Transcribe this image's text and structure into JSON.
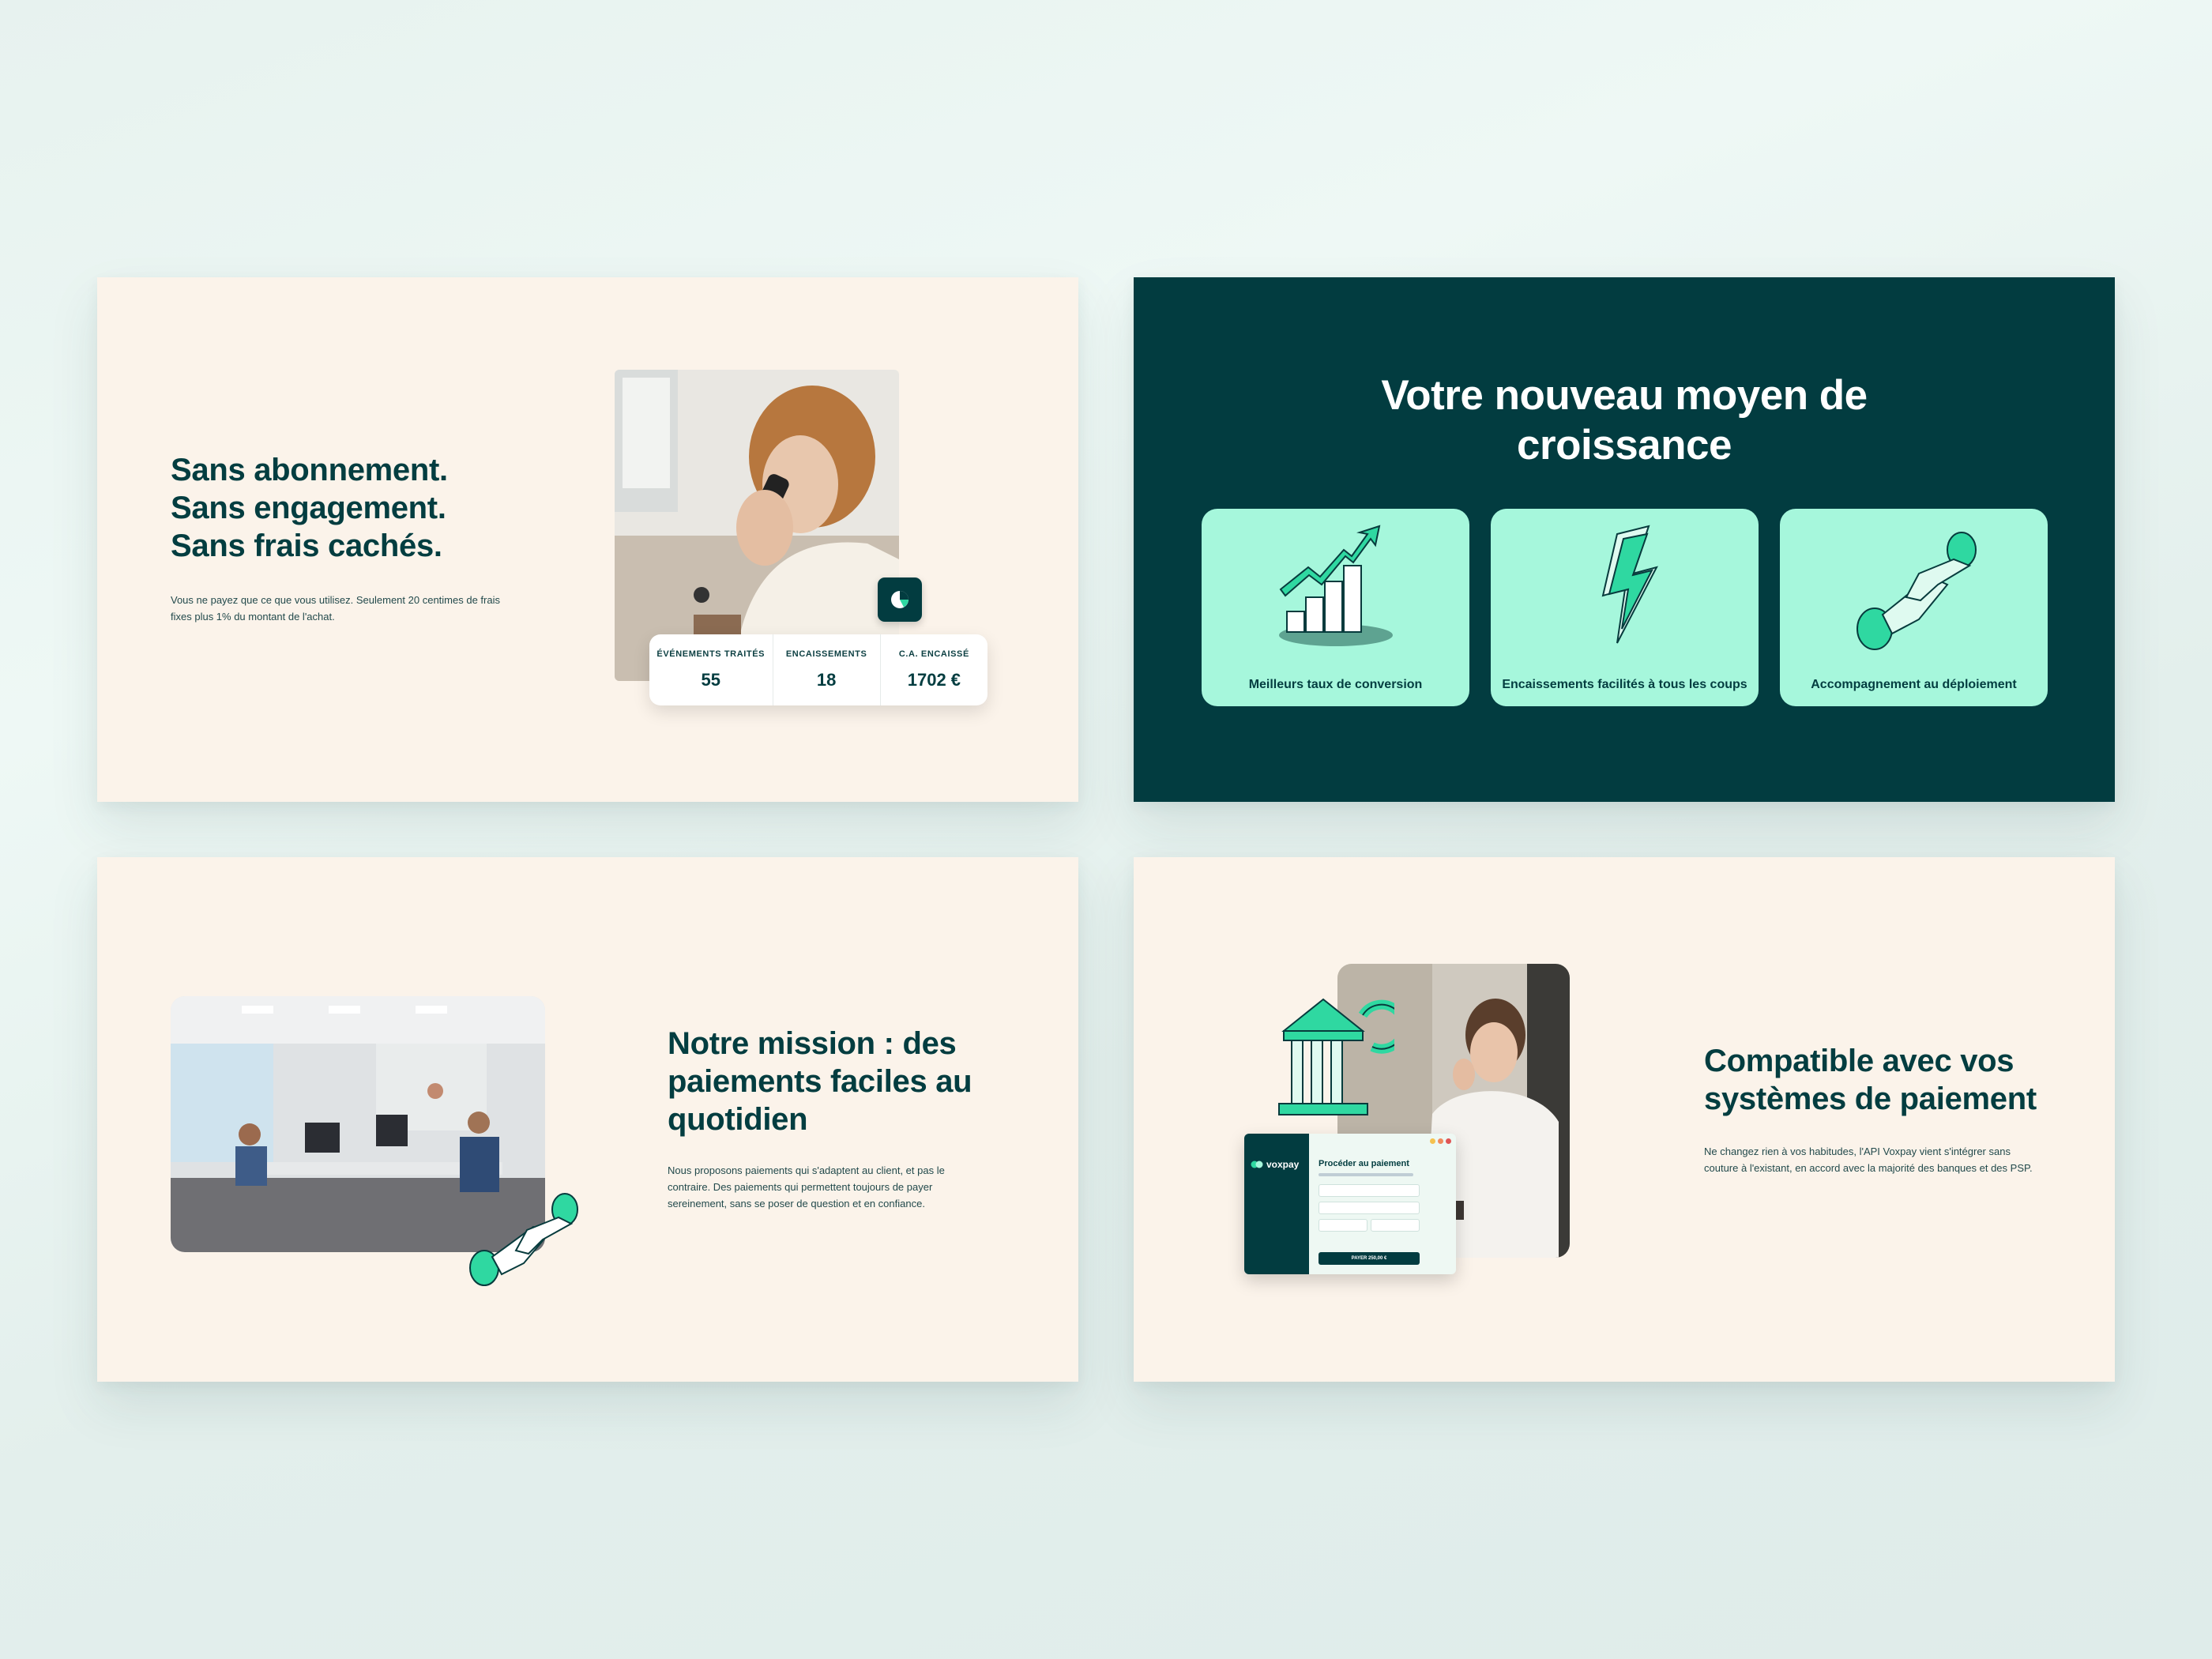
{
  "card1": {
    "heading": "Sans abonnement.\nSans engagement.\nSans frais cachés.",
    "body": "Vous ne payez que ce que vous utilisez. Seulement 20 centimes de frais fixes plus 1% du montant de l'achat.",
    "stats": [
      {
        "label": "ÉVÉNEMENTS TRAITÉS",
        "value": "55"
      },
      {
        "label": "ENCAISSEMENTS",
        "value": "18"
      },
      {
        "label": "C.A. ENCAISSÉ",
        "value": "1702 €"
      }
    ],
    "icon": "pie-chart-icon"
  },
  "card2": {
    "heading": "Votre nouveau moyen de\ncroissance",
    "features": [
      {
        "label": "Meilleurs taux de conversion",
        "icon": "growth-chart-icon"
      },
      {
        "label": "Encaissements facilités à tous les coups",
        "icon": "lightning-icon"
      },
      {
        "label": "Accompagnement au déploiement",
        "icon": "handshake-icon"
      }
    ]
  },
  "card3": {
    "heading": "Notre mission : des\npaiements faciles au\nquotidien",
    "body": "Nous proposons paiements qui s'adaptent au client, et pas le contraire. Des paiements qui permettent toujours de payer sereinement, sans se poser de question et en confiance."
  },
  "card4": {
    "heading": "Compatible avec vos\nsystèmes de paiement",
    "body": "Ne changez rien à vos habitudes, l'API Voxpay vient s'intégrer sans couture à l'existant, en accord avec la majorité des banques et des PSP.",
    "checkout": {
      "brand": "voxpay",
      "title": "Procéder au paiement",
      "pay_label": "PAYER 250,00 €"
    }
  },
  "colors": {
    "dark": "#023c40",
    "cream": "#fbf3ea",
    "mint": "#a6f7dc",
    "accent": "#2fd8a1"
  }
}
